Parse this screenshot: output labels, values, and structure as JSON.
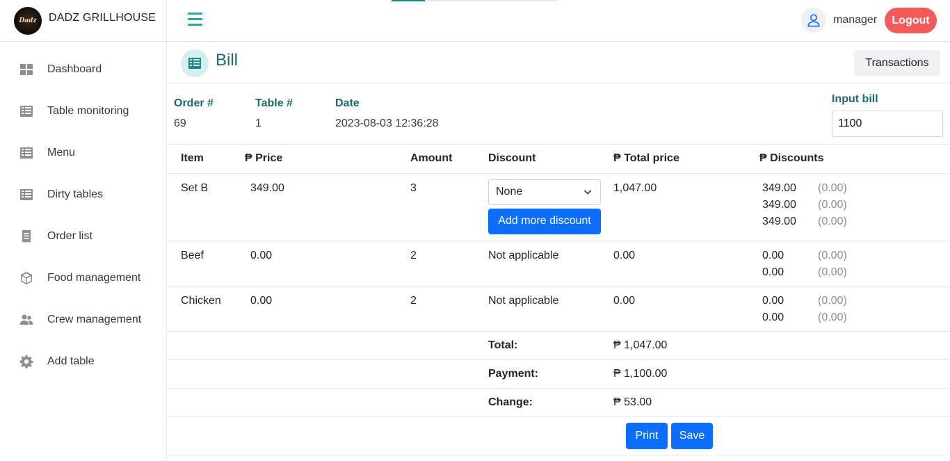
{
  "brand": {
    "name": "DADZ GRILLHOUSE",
    "logo_text": "Dadz"
  },
  "sidebar": {
    "items": [
      {
        "label": "Dashboard",
        "icon": "dashboard-icon"
      },
      {
        "label": "Table monitoring",
        "icon": "table-list-icon"
      },
      {
        "label": "Menu",
        "icon": "table-list-icon"
      },
      {
        "label": "Dirty tables",
        "icon": "table-list-icon"
      },
      {
        "label": "Order list",
        "icon": "receipt-icon"
      },
      {
        "label": "Food management",
        "icon": "box-icon"
      },
      {
        "label": "Crew management",
        "icon": "users-icon"
      },
      {
        "label": "Add table",
        "icon": "gear-icon"
      }
    ]
  },
  "header": {
    "user_name": "manager",
    "logout_label": "Logout",
    "loading_progress": 0.2
  },
  "page": {
    "title": "Bill",
    "transactions_label": "Transactions"
  },
  "order_info": {
    "order_label": "Order #",
    "order_value": "69",
    "table_label": "Table #",
    "table_value": "1",
    "date_label": "Date",
    "date_value": "2023-08-03 12:36:28",
    "input_bill_label": "Input bill",
    "input_bill_value": "1100"
  },
  "table": {
    "headers": [
      "Item",
      "₱ Price",
      "Amount",
      "Discount",
      "₱ Total price",
      "₱ Discounts"
    ],
    "rows": [
      {
        "item": "Set B",
        "price": "349.00",
        "amount": "3",
        "discount": "None",
        "add_discount_label": "Add more discount",
        "total": "1,047.00",
        "discounts": [
          {
            "amount": "349.00",
            "disc": "(0.00)"
          },
          {
            "amount": "349.00",
            "disc": "(0.00)"
          },
          {
            "amount": "349.00",
            "disc": "(0.00)"
          }
        ]
      },
      {
        "item": "Beef",
        "price": "0.00",
        "amount": "2",
        "discount": "Not applicable",
        "total": "0.00",
        "discounts": [
          {
            "amount": "0.00",
            "disc": "(0.00)"
          },
          {
            "amount": "0.00",
            "disc": "(0.00)"
          }
        ]
      },
      {
        "item": "Chicken",
        "price": "0.00",
        "amount": "2",
        "discount": "Not applicable",
        "total": "0.00",
        "discounts": [
          {
            "amount": "0.00",
            "disc": "(0.00)"
          },
          {
            "amount": "0.00",
            "disc": "(0.00)"
          }
        ]
      }
    ]
  },
  "summary": {
    "total_label": "Total:",
    "total_value": "₱ 1,047.00",
    "payment_label": "Payment:",
    "payment_value": "₱ 1,100.00",
    "change_label": "Change:",
    "change_value": "₱ 53.00"
  },
  "actions": {
    "print_label": "Print",
    "save_label": "Save"
  },
  "colors": {
    "accent": "#1b6b6b",
    "primary": "#0d6efd",
    "logout": "#f35b5b",
    "hamburger": "#2aa8a0"
  }
}
